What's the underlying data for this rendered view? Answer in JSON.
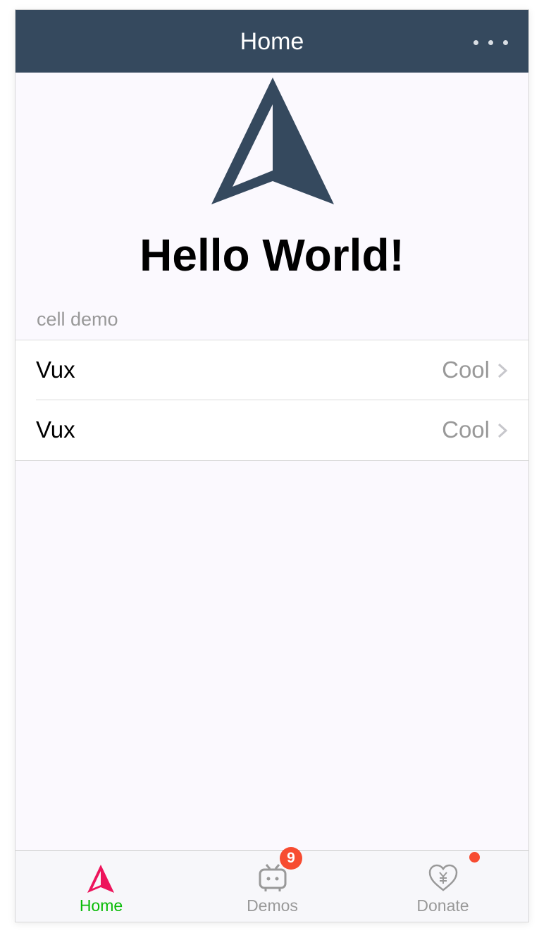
{
  "header": {
    "title": "Home",
    "more_icon": "more-dots-icon"
  },
  "main": {
    "logo_icon": "vux-logo-icon",
    "heading": "Hello World!",
    "group_title": "cell demo",
    "cells": [
      {
        "label": "Vux",
        "value": "Cool",
        "icon": "chevron-right-icon"
      },
      {
        "label": "Vux",
        "value": "Cool",
        "icon": "chevron-right-icon"
      }
    ]
  },
  "tabbar": {
    "tabs": [
      {
        "label": "Home",
        "icon": "vux-logo-icon",
        "active": true
      },
      {
        "label": "Demos",
        "icon": "tv-icon",
        "badge": "9"
      },
      {
        "label": "Donate",
        "icon": "heart-yen-icon",
        "reddot": true
      }
    ]
  },
  "colors": {
    "header_bg": "#35495e",
    "logo": "#35495e",
    "active_tab": "#09bb07",
    "active_tab_icon": "#ed145b",
    "badge": "#f74c31",
    "page_bg": "#fbf9fe"
  }
}
